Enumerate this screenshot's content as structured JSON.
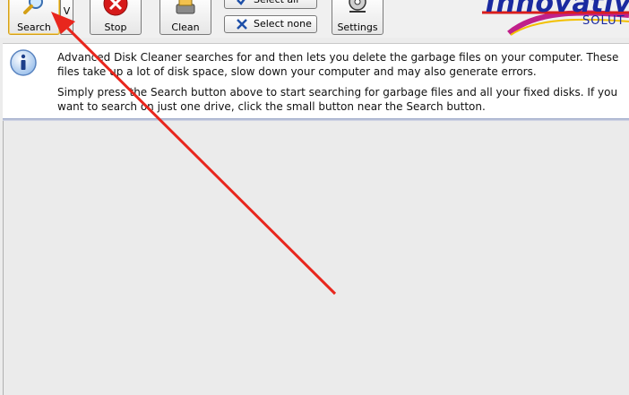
{
  "toolbar": {
    "search_label": "Search",
    "search_dropdown": "V",
    "stop_label": "Stop",
    "clean_label": "Clean",
    "select_all_label": "Select all",
    "select_none_label": "Select none",
    "settings_label": "Settings"
  },
  "logo": {
    "text": "Innovativ",
    "subtext": "SOLUT"
  },
  "info": {
    "paragraph1": "Advanced Disk Cleaner searches for and then lets you delete the garbage files on your computer. These files take up a lot of disk space, slow down your computer and may also generate errors.",
    "paragraph2": "Simply press the Search button above to start searching for garbage files and all your fixed disks. If you want to search on just one drive, click the small button near the Search button."
  },
  "icons": {
    "search": "magnifier-icon",
    "stop": "stop-icon",
    "clean": "broom-icon",
    "select_all": "checkmark-icon",
    "select_none": "x-icon",
    "settings": "gear-icon",
    "info": "info-icon"
  },
  "colors": {
    "logo_blue": "#1a2aa0",
    "annotation_arrow": "#e8261d"
  }
}
